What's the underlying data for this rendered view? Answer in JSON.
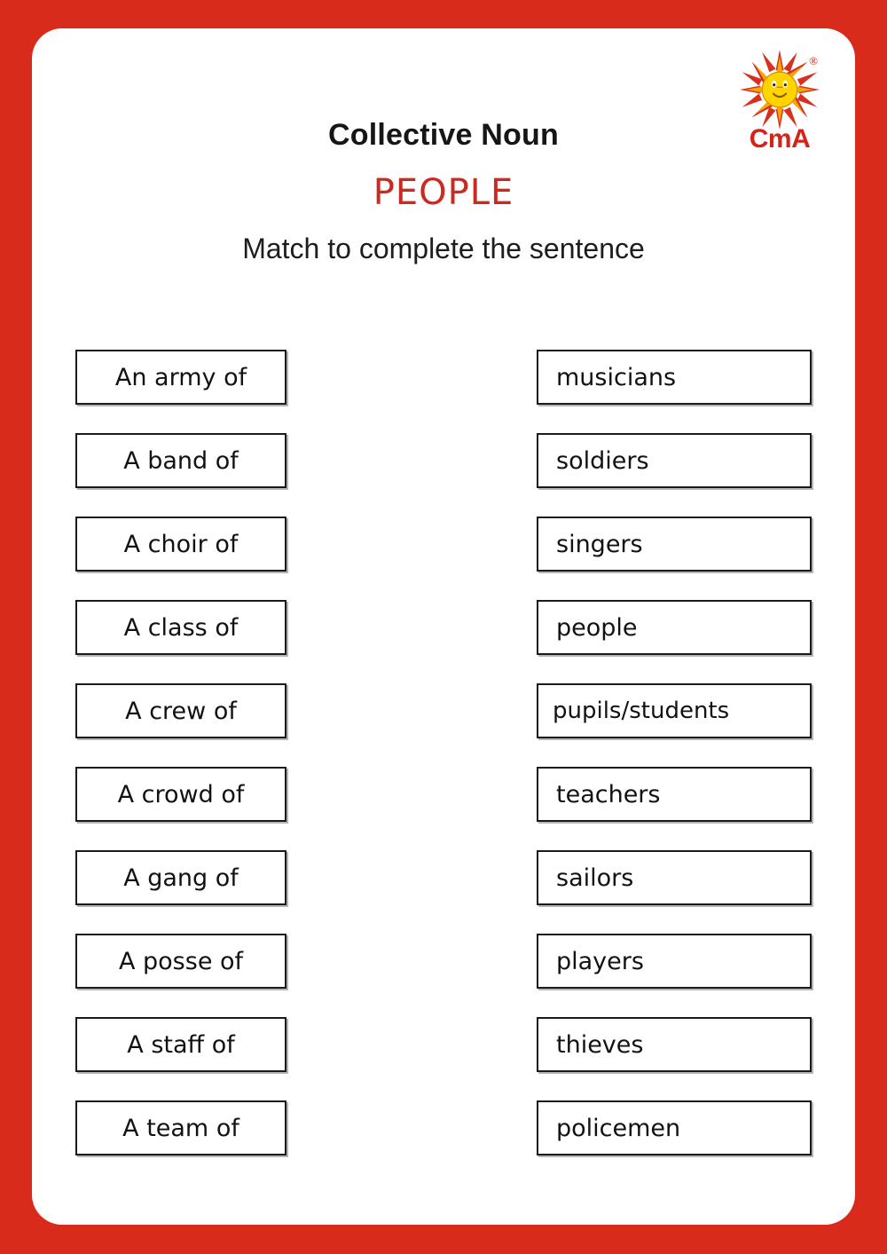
{
  "logo": {
    "icon": "smiling-sun-icon",
    "brand": "CmA",
    "registered_mark": "®",
    "colors": {
      "ray_outer": "#d8301f",
      "ray_inner": "#f5a800",
      "disc": "#ffd600",
      "brand_text": "#d4241a"
    }
  },
  "heading": {
    "title": "Collective Noun",
    "topic": "PEOPLE",
    "topic_color": "#cc2a20",
    "instruction": "Match to complete the sentence"
  },
  "frame": {
    "border_color": "#d92b1c",
    "page_color": "#ffffff"
  },
  "match": {
    "left_column": [
      {
        "label": "An army of"
      },
      {
        "label": "A band of"
      },
      {
        "label": "A choir of"
      },
      {
        "label": "A class of"
      },
      {
        "label": "A crew of"
      },
      {
        "label": "A crowd of"
      },
      {
        "label": "A gang of"
      },
      {
        "label": "A posse of"
      },
      {
        "label": "A staff of"
      },
      {
        "label": "A team of"
      }
    ],
    "right_column": [
      {
        "label": "musicians"
      },
      {
        "label": "soldiers"
      },
      {
        "label": "singers"
      },
      {
        "label": "people"
      },
      {
        "label": "pupils/students"
      },
      {
        "label": "teachers"
      },
      {
        "label": "sailors"
      },
      {
        "label": "players"
      },
      {
        "label": "thieves"
      },
      {
        "label": "policemen"
      }
    ]
  }
}
